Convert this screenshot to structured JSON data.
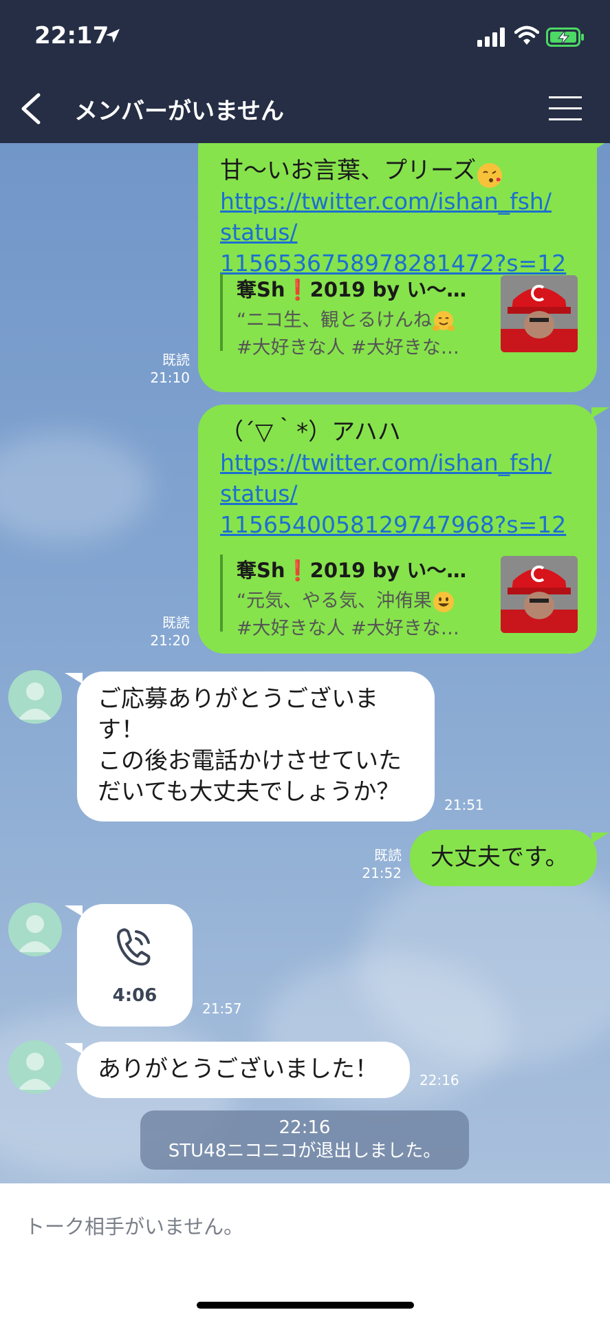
{
  "status_bar": {
    "time": "22:17"
  },
  "header": {
    "title": "メンバーがいません"
  },
  "messages": [
    {
      "text": "甘〜いお言葉、プリーズ",
      "link_lines": [
        "https://twitter.com/ishan_fsh/",
        "status/",
        "1156536758978281472?s=12"
      ],
      "preview_title": "奪Sh❗️2019 by い〜…",
      "preview_desc_1": "“ニコ生、観とるけんね",
      "preview_desc_2": "#大好きな人 #大好きな…",
      "read": "既読",
      "time": "21:10"
    },
    {
      "text": "（´▽｀*）アハハ",
      "link_lines": [
        "https://twitter.com/ishan_fsh/",
        "status/",
        "1156540058129747968?s=12"
      ],
      "preview_title": "奪Sh❗️2019 by い〜…",
      "preview_desc_1": "“元気、やる気、沖侑果",
      "preview_desc_2": "#大好きな人 #大好きな…",
      "read": "既読",
      "time": "21:20"
    },
    {
      "lines": [
        "ご応募ありがとうございま",
        "す！",
        "この後お電話かけさせていた",
        "だいても大丈夫でしょうか？"
      ],
      "time": "21:51"
    },
    {
      "text": "大丈夫です。",
      "read": "既読",
      "time": "21:52"
    },
    {
      "call_duration": "4:06",
      "time": "21:57"
    },
    {
      "text": "ありがとうございました！",
      "time": "22:16"
    }
  ],
  "system_message": {
    "time": "22:16",
    "text": "STU48ニコニコが退出しました。"
  },
  "input": {
    "placeholder": "トーク相手がいません。"
  },
  "colors": {
    "header": "#252e44",
    "out_bubble": "#86e34c",
    "link": "#1c6fd0"
  }
}
